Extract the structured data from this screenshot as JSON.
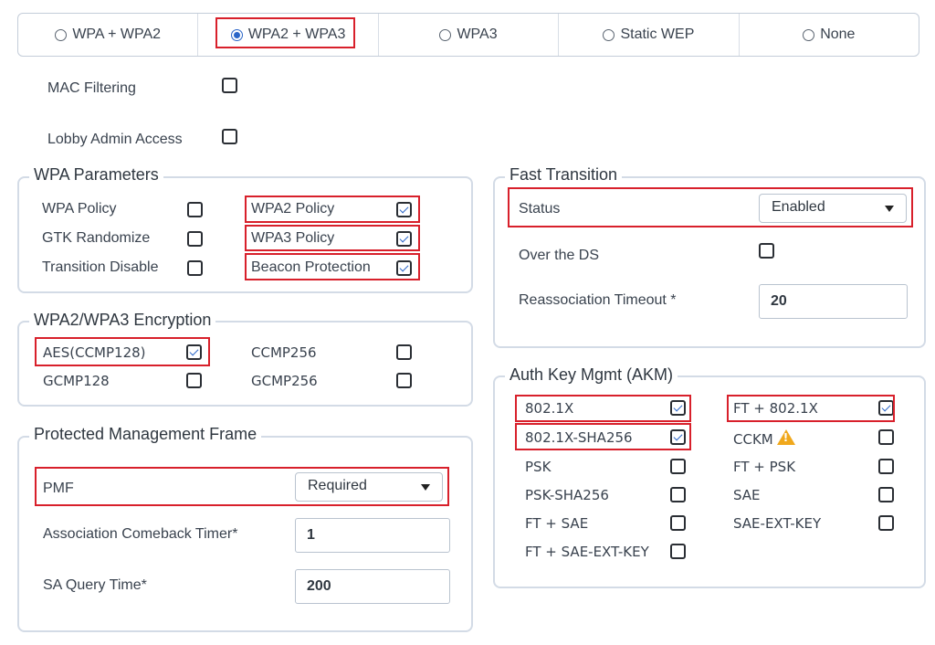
{
  "security_modes": [
    {
      "label": "WPA + WPA2",
      "selected": false
    },
    {
      "label": "WPA2 + WPA3",
      "selected": true
    },
    {
      "label": "WPA3",
      "selected": false
    },
    {
      "label": "Static WEP",
      "selected": false
    },
    {
      "label": "None",
      "selected": false
    }
  ],
  "mac_filtering": {
    "label": "MAC Filtering",
    "checked": false
  },
  "lobby_admin": {
    "label": "Lobby Admin Access",
    "checked": false
  },
  "wpa_params": {
    "title": "WPA Parameters",
    "wpa_policy": {
      "label": "WPA Policy",
      "checked": false
    },
    "gtk_randomize": {
      "label": "GTK Randomize",
      "checked": false
    },
    "transition_disable": {
      "label": "Transition Disable",
      "checked": false
    },
    "wpa2_policy": {
      "label": "WPA2 Policy",
      "checked": true
    },
    "wpa3_policy": {
      "label": "WPA3 Policy",
      "checked": true
    },
    "beacon_protection": {
      "label": "Beacon Protection",
      "checked": true
    }
  },
  "encryption": {
    "title": "WPA2/WPA3 Encryption",
    "aes": {
      "label": "AES(CCMP128)",
      "checked": true
    },
    "gcmp128": {
      "label": "GCMP128",
      "checked": false
    },
    "ccmp256": {
      "label": "CCMP256",
      "checked": false
    },
    "gcmp256": {
      "label": "GCMP256",
      "checked": false
    }
  },
  "pmf": {
    "title": "Protected Management Frame",
    "pmf_label": "PMF",
    "pmf_value": "Required",
    "comeback_label": "Association Comeback Timer*",
    "comeback_value": "1",
    "sa_query_label": "SA Query Time*",
    "sa_query_value": "200"
  },
  "fast_transition": {
    "title": "Fast Transition",
    "status_label": "Status",
    "status_value": "Enabled",
    "over_ds_label": "Over the DS",
    "over_ds_checked": false,
    "reassoc_label": "Reassociation Timeout *",
    "reassoc_value": "20"
  },
  "akm": {
    "title": "Auth Key Mgmt (AKM)",
    "items": {
      "dot1x": {
        "label": "802.1X",
        "checked": true
      },
      "dot1x_sha256": {
        "label": "802.1X-SHA256",
        "checked": true
      },
      "psk": {
        "label": "PSK",
        "checked": false
      },
      "psk_sha256": {
        "label": "PSK-SHA256",
        "checked": false
      },
      "ft_sae": {
        "label": "FT + SAE",
        "checked": false
      },
      "ft_sae_ext": {
        "label": "FT + SAE-EXT-KEY",
        "checked": false
      },
      "ft_dot1x": {
        "label": "FT + 802.1X",
        "checked": true
      },
      "cckm": {
        "label": "CCKM",
        "checked": false
      },
      "ft_psk": {
        "label": "FT + PSK",
        "checked": false
      },
      "sae": {
        "label": "SAE",
        "checked": false
      },
      "sae_ext": {
        "label": "SAE-EXT-KEY",
        "checked": false
      }
    }
  },
  "colors": {
    "accent": "#2b66c8",
    "highlight": "#d8202b",
    "border": "#d3dbe6",
    "warning": "#f0a81c"
  }
}
